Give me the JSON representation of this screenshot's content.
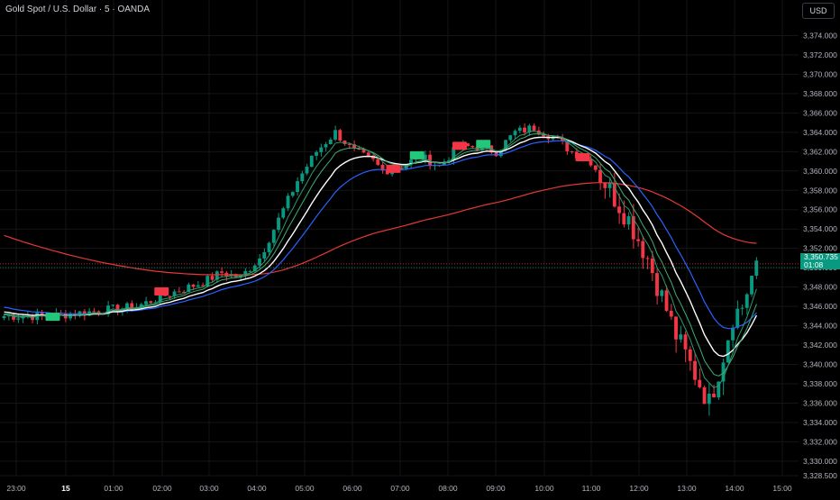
{
  "header": {
    "symbol_title": "Gold Spot / U.S. Dollar · 5 · OANDA",
    "currency": "USD"
  },
  "price_tag": {
    "price": "3,350.735",
    "countdown": "01:08"
  },
  "colors": {
    "up": "#089981",
    "down": "#f23645",
    "background": "#000000",
    "ema_white": "#ffffff",
    "ema_green1": "#2e9a6a",
    "ema_green2": "#3fae73",
    "ema_blue": "#2962ff",
    "ema_red": "#e53935"
  },
  "chart_data": {
    "type": "candlestick",
    "y_axis": {
      "min": 3328.5,
      "max": 3376,
      "ticks": [
        "3,374.000",
        "3,372.000",
        "3,370.000",
        "3,368.000",
        "3,366.000",
        "3,364.000",
        "3,362.000",
        "3,360.000",
        "3,358.000",
        "3,356.000",
        "3,354.000",
        "3,352.000",
        "3,350.000",
        "3,348.000",
        "3,346.000",
        "3,344.000",
        "3,342.000",
        "3,340.000",
        "3,338.000",
        "3,336.000",
        "3,334.000",
        "3,332.000",
        "3,330.000",
        "3,328.500"
      ]
    },
    "x_axis": {
      "labels": [
        "23:00",
        "15",
        "01:00",
        "02:00",
        "03:00",
        "04:00",
        "05:00",
        "06:00",
        "07:00",
        "08:00",
        "09:00",
        "10:00",
        "11:00",
        "12:00",
        "13:00",
        "14:00",
        "15:00"
      ]
    },
    "price_path": [
      [
        0,
        3345.0
      ],
      [
        10,
        3345.0
      ],
      [
        28,
        3346.0
      ],
      [
        36,
        3347.5
      ],
      [
        42,
        3348.5
      ],
      [
        46,
        3349.5
      ],
      [
        50,
        3349.0
      ],
      [
        54,
        3351.0
      ],
      [
        58,
        3355.0
      ],
      [
        62,
        3359.0
      ],
      [
        66,
        3362.0
      ],
      [
        70,
        3364.0
      ],
      [
        74,
        3362.0
      ],
      [
        78,
        3361.0
      ],
      [
        80,
        3360.0
      ],
      [
        84,
        3360.5
      ],
      [
        88,
        3361.5
      ],
      [
        92,
        3360.5
      ],
      [
        96,
        3362.5
      ],
      [
        100,
        3362.5
      ],
      [
        104,
        3362.0
      ],
      [
        108,
        3364.0
      ],
      [
        112,
        3364.5
      ],
      [
        116,
        3363.5
      ],
      [
        120,
        3362.0
      ],
      [
        124,
        3361.0
      ],
      [
        128,
        3358.0
      ],
      [
        132,
        3355.0
      ],
      [
        136,
        3351.0
      ],
      [
        139,
        3347.0
      ],
      [
        142,
        3343.0
      ],
      [
        146,
        3339.0
      ],
      [
        149,
        3336.0
      ],
      [
        152,
        3341.0
      ],
      [
        154,
        3345.0
      ],
      [
        156,
        3346.0
      ],
      [
        159,
        3350.7
      ]
    ],
    "signal_markers": [
      {
        "bar": 10,
        "side": "buy"
      },
      {
        "bar": 33,
        "side": "sell"
      },
      {
        "bar": 82,
        "side": "sell"
      },
      {
        "bar": 87,
        "side": "buy"
      },
      {
        "bar": 96,
        "side": "sell"
      },
      {
        "bar": 101,
        "side": "buy"
      },
      {
        "bar": 122,
        "side": "sell"
      }
    ],
    "last_price": 3350.735,
    "horizontal_lines": [
      3350.4,
      3350.0
    ],
    "indicators": [
      "EMA fast (green)",
      "EMA mid (green)",
      "EMA (white)",
      "EMA (blue)",
      "EMA long (red)"
    ]
  }
}
